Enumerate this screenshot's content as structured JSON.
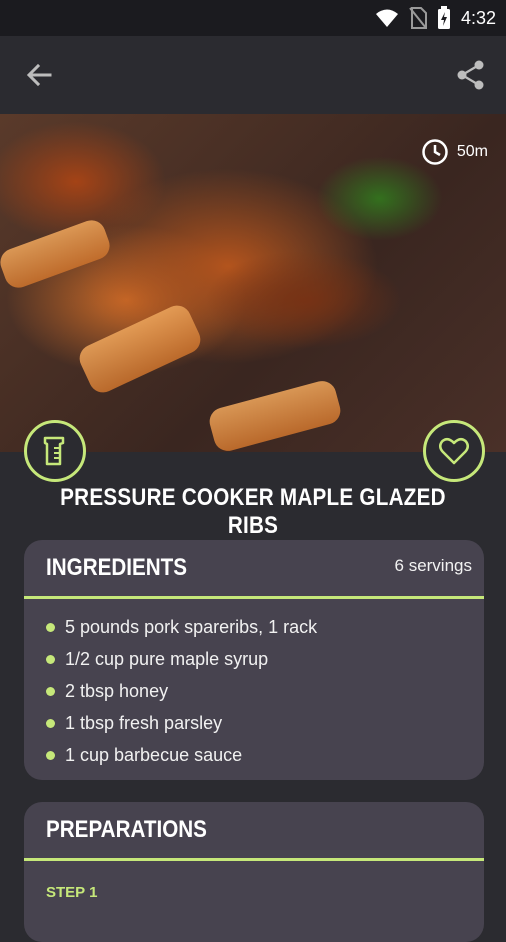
{
  "status_bar": {
    "time": "4:32",
    "icons": [
      "wifi-icon",
      "no-sim-icon",
      "battery-charging-icon"
    ]
  },
  "app_bar": {
    "back_icon": "arrow-left-icon",
    "share_icon": "share-icon"
  },
  "hero": {
    "image_description": "glazed ribs photo",
    "cook_time": "50m",
    "clock_icon": "clock-icon"
  },
  "actions": {
    "measure_icon": "measuring-cup-icon",
    "favorite_icon": "heart-icon"
  },
  "recipe": {
    "title": "PRESSURE COOKER MAPLE GLAZED RIBS"
  },
  "ingredients": {
    "heading": "INGREDIENTS",
    "servings": "6 servings",
    "items": [
      "5 pounds pork spareribs, 1 rack",
      "1/2 cup pure maple syrup",
      "2 tbsp honey",
      "1 tbsp fresh parsley",
      "1 cup barbecue sauce"
    ]
  },
  "preparations": {
    "heading": "PREPARATIONS",
    "step_label": "STEP 1"
  },
  "colors": {
    "accent": "#c6e87a",
    "background": "#2b2b30",
    "card": "#47434f",
    "status_bar": "#1b1b1f"
  }
}
